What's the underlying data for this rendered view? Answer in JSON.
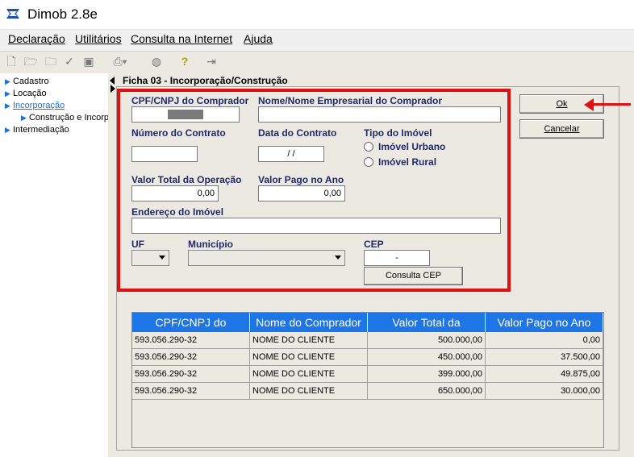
{
  "window": {
    "title": "Dimob 2.8e"
  },
  "menu": {
    "items": [
      "Declaração",
      "Utilitários",
      "Consulta na Internet",
      "Ajuda"
    ]
  },
  "tree": {
    "items": [
      {
        "label": "Cadastro"
      },
      {
        "label": "Locação"
      },
      {
        "label": "Incorporação"
      },
      {
        "label": "Construção e Incorp"
      },
      {
        "label": "Intermediação"
      }
    ]
  },
  "form": {
    "title": "Ficha 03 - Incorporação/Construção",
    "cpf_label": "CPF/CNPJ do Comprador",
    "nome_label": "Nome/Nome Empresarial do Comprador",
    "contrato_label": "Número do Contrato",
    "data_label": "Data do Contrato",
    "data_value": "/ /",
    "tipo_label": "Tipo do Imóvel",
    "urbano_label": "Imóvel Urbano",
    "rural_label": "Imóvel Rural",
    "valor_total_label": "Valor Total da Operação",
    "valor_total_value": "0,00",
    "valor_pago_label": "Valor Pago no Ano",
    "valor_pago_value": "0,00",
    "endereco_label": "Endereço do Imóvel",
    "uf_label": "UF",
    "municipio_label": "Município",
    "cep_label": "CEP",
    "cep_value": "-",
    "consulta_cep_label": "Consulta CEP"
  },
  "buttons": {
    "ok": "Ok",
    "cancelar": "Cancelar"
  },
  "table": {
    "headers": [
      "CPF/CNPJ do",
      "Nome do Comprador",
      "Valor Total da",
      "Valor Pago no Ano"
    ],
    "rows": [
      [
        "593.056.290-32",
        "NOME DO CLIENTE",
        "500.000,00",
        "0,00"
      ],
      [
        "593.056.290-32",
        "NOME DO CLIENTE",
        "450.000,00",
        "37.500,00"
      ],
      [
        "593.056.290-32",
        "NOME DO CLIENTE",
        "399.000,00",
        "49.875,00"
      ],
      [
        "593.056.290-32",
        "NOME DO CLIENTE",
        "650.000,00",
        "30.000,00"
      ]
    ]
  },
  "colors": {
    "highlight": "#e01010",
    "header": "#1e76e6",
    "label": "#1f2a6b"
  }
}
